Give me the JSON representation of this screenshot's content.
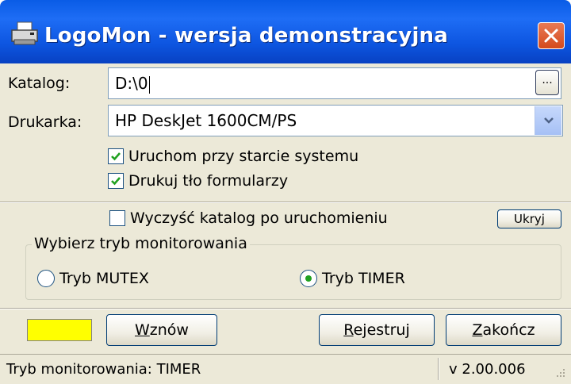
{
  "window": {
    "title": "LogoMon - wersja demonstracyjna",
    "accent_color": "#0a5ce6",
    "icons": {
      "app": "printer-icon",
      "close": "close-icon"
    }
  },
  "form": {
    "catalog_label": "Katalog:",
    "catalog_value": "D:\\0",
    "browse_label": "...",
    "printer_label": "Drukarka:",
    "printer_value": "HP DeskJet 1600CM/PS",
    "run_on_startup": {
      "label": "Uruchom przy starcie systemu",
      "checked": true
    },
    "print_background": {
      "label": "Drukuj tło formularzy",
      "checked": true
    }
  },
  "options": {
    "clear_catalog": {
      "label": "Wyczyść katalog po uruchomieniu",
      "checked": false
    },
    "hide_label": "Ukryj"
  },
  "monitor_mode": {
    "group_title": "Wybierz tryb monitorowania",
    "mutex": {
      "label": "Tryb MUTEX",
      "selected": false
    },
    "timer": {
      "label": "Tryb TIMER",
      "selected": true
    }
  },
  "actions": {
    "indicator_color": "#ffff00",
    "resume_rest": "znów",
    "resume_key": "W",
    "register_rest": "ejestruj",
    "register_key": "R",
    "finish_rest": "akończ",
    "finish_key": "Z"
  },
  "statusbar": {
    "mode_text": "Tryb monitorowania: TIMER",
    "version": "v 2.00.006"
  }
}
